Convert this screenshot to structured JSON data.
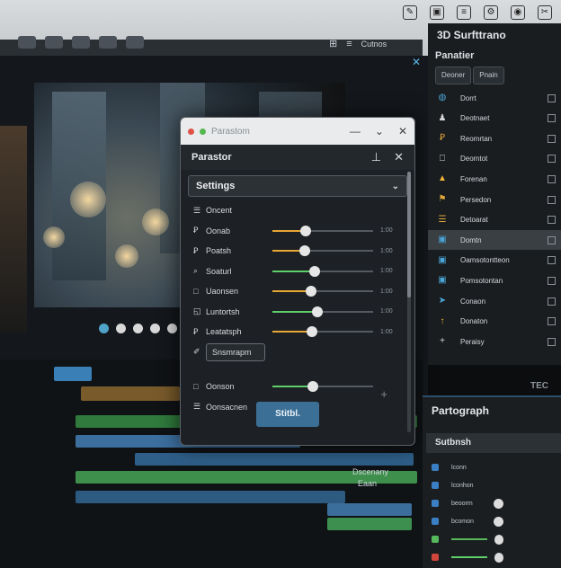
{
  "app": {
    "panel_title": "3D Surfttrano",
    "top_right_label": "Cutnos"
  },
  "top_icons": [
    "edit-icon",
    "crop-icon",
    "layers-icon",
    "gear-icon",
    "camera-icon",
    "scissors-icon"
  ],
  "dialog": {
    "title": "Parastom",
    "header": "Parastor",
    "section": "Settings",
    "rows": [
      {
        "icon": "list-icon",
        "label": "Oncent",
        "value": null
      },
      {
        "icon": "text-icon",
        "label": "Oonab",
        "value": 0.33
      },
      {
        "icon": "text-icon",
        "label": "Poatsh",
        "value": 0.32
      },
      {
        "icon": "search-icon",
        "label": "Soaturl",
        "value": 0.42
      },
      {
        "icon": "square-icon",
        "label": "Uaonsen",
        "value": 0.38
      },
      {
        "icon": "chart-icon",
        "label": "Luntortsh",
        "value": 0.45
      },
      {
        "icon": "text-icon",
        "label": "Leatatsph",
        "value": 0.39
      },
      {
        "icon": "pen-icon",
        "label": "Snsmrapm",
        "value": null
      },
      {
        "icon": "square-icon",
        "label": "Oonson",
        "value": 0.4
      },
      {
        "icon": "list-icon",
        "label": "Oonsacnen",
        "value": null
      }
    ],
    "slider_ticks": [
      "1:00",
      "1:00",
      "1:00",
      "1:00",
      "1:00",
      "1:00"
    ],
    "submit_label": "Stitbl."
  },
  "right_panel": {
    "title": "Panatier",
    "tabs": [
      "Deoner",
      "Pnain"
    ],
    "items": [
      {
        "icon": "droplet-icon",
        "label": "Dorrt"
      },
      {
        "icon": "person-icon",
        "label": "Deotnaet"
      },
      {
        "icon": "text-icon",
        "label": "Reomrtan"
      },
      {
        "icon": "doc-icon",
        "label": "Deomtot"
      },
      {
        "icon": "triangle-icon",
        "label": "Forenan"
      },
      {
        "icon": "flag-icon",
        "label": "Persedon"
      },
      {
        "icon": "list-icon",
        "label": "Detoarat"
      },
      {
        "icon": "box-icon",
        "label": "Domtn"
      },
      {
        "icon": "box-icon",
        "label": "Oamsotontteon"
      },
      {
        "icon": "box-icon",
        "label": "Pomsotontan"
      },
      {
        "icon": "arrow-icon",
        "label": "Conaon"
      },
      {
        "icon": "up-icon",
        "label": "Donaton"
      },
      {
        "icon": "plus-icon",
        "label": "Peraisy"
      }
    ]
  },
  "paragraph_panel": {
    "title": "Partograph",
    "sub": "Sutbnsh",
    "side_label": "TEC",
    "rows": [
      {
        "color": "#3a7fc4",
        "label": "lconn",
        "knob": false
      },
      {
        "color": "#3a7fc4",
        "label": "lconhon",
        "knob": false
      },
      {
        "color": "#3a7fc4",
        "label": "beoorm",
        "knob": true
      },
      {
        "color": "#3a7fc4",
        "label": "bcomon",
        "knob": true
      },
      {
        "color": "#55b85a",
        "label": "",
        "knob": true
      },
      {
        "color": "#d2453b",
        "label": "",
        "knob": true
      }
    ]
  },
  "timeline": {
    "clip_label": "Dscenany",
    "clip_label2": "Eaan"
  }
}
